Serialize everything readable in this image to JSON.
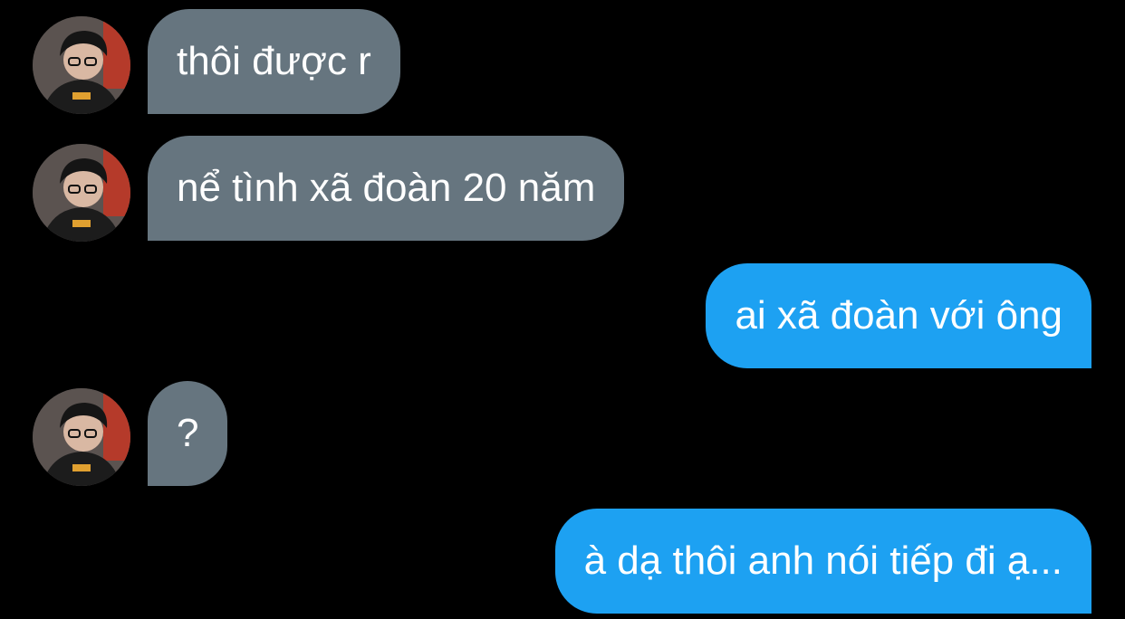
{
  "conversation": {
    "messages": [
      {
        "sender": "other",
        "text": "thôi được r"
      },
      {
        "sender": "other",
        "text": "nể tình xã đoàn 20 năm"
      },
      {
        "sender": "me",
        "text": "ai xã đoàn với ông"
      },
      {
        "sender": "other",
        "text": "?"
      },
      {
        "sender": "me",
        "text": "à dạ thôi anh nói tiếp đi ạ..."
      }
    ]
  },
  "colors": {
    "background": "#000000",
    "incoming_bubble": "#66757f",
    "outgoing_bubble": "#1da1f2",
    "text": "#ffffff"
  },
  "icons": {
    "avatar": "profile-photo"
  }
}
